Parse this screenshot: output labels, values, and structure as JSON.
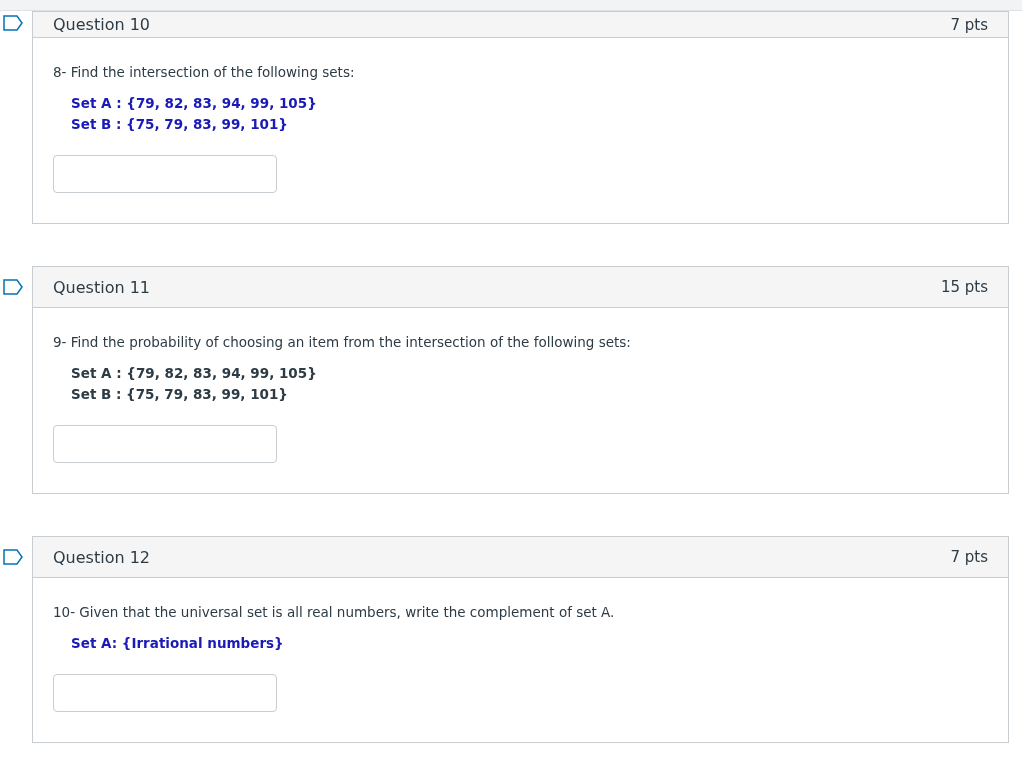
{
  "questions": [
    {
      "title": "Question 10",
      "points": "7 pts",
      "flagged": false,
      "prompt": "8- Find the intersection of the following sets:",
      "sets": [
        {
          "text": "Set A : {79, 82, 83, 94, 99, 105}",
          "color": "#1a1ab8"
        },
        {
          "text": "Set B : {75, 79, 83, 99, 101}",
          "color": "#1a1ab8"
        }
      ]
    },
    {
      "title": "Question 11",
      "points": "15 pts",
      "flagged": false,
      "prompt": "9- Find the probability of choosing an item from the intersection of the following sets:",
      "sets": [
        {
          "text": "Set A : {79, 82, 83, 94, 99, 105}",
          "color": "#2d3b45"
        },
        {
          "text": "Set B : {75, 79, 83, 99, 101}",
          "color": "#2d3b45"
        }
      ]
    },
    {
      "title": "Question 12",
      "points": "7 pts",
      "flagged": false,
      "prompt": "10- Given that the universal set is all real numbers, write the complement of set A.",
      "sets": [
        {
          "text": "Set A: {Irrational numbers}",
          "color": "#1a1ab8"
        }
      ]
    }
  ]
}
